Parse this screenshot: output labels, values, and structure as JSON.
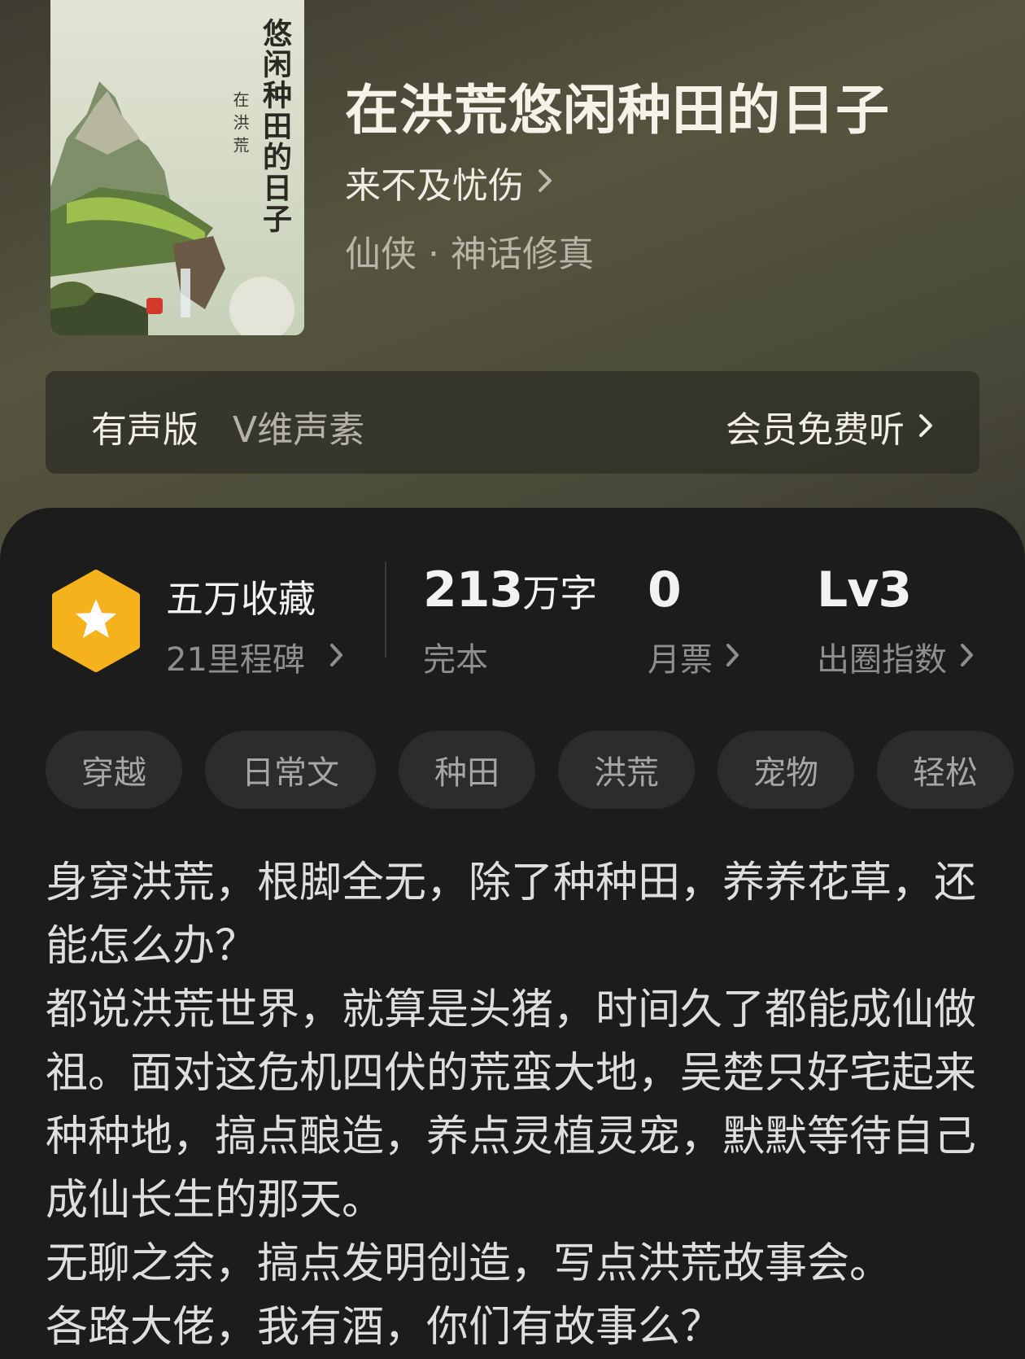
{
  "book": {
    "title": "在洪荒悠闲种田的日子",
    "author": "来不及忧伤",
    "genre": "仙侠 · 神话修真",
    "cover": {
      "title": "悠闲种田的日子",
      "subtitle": "在洪荒"
    }
  },
  "audio": {
    "label": "有声版",
    "narrator": "V维声素",
    "action": "会员免费听"
  },
  "stats": {
    "favorites": "五万收藏",
    "milestones": "21里程碑",
    "words_number": "213",
    "words_unit": "万字",
    "status": "完本",
    "monthly_votes": "0",
    "monthly_votes_label": "月票",
    "level": "Lv3",
    "level_label": "出圈指数"
  },
  "tags": [
    "穿越",
    "日常文",
    "种田",
    "洪荒",
    "宠物",
    "轻松"
  ],
  "description": [
    "身穿洪荒，根脚全无，除了种种田，养养花草，还能怎么办？",
    "都说洪荒世界，就算是头猪，时间久了都能成仙做祖。面对这危机四伏的荒蛮大地，吴楚只好宅起来种种地，搞点酿造，养点灵植灵宠，默默等待自己成仙长生的那天。",
    "无聊之余，搞点发明创造，写点洪荒故事会。",
    "各路大佬，我有酒，你们有故事么？"
  ],
  "colors": {
    "badge": "#F5B21C",
    "panel": "#1C1C1C",
    "tag_bg": "#2C2C2C"
  },
  "icons": {
    "badge": "star-hexagon-icon",
    "chevron": "chevron-right-icon"
  }
}
